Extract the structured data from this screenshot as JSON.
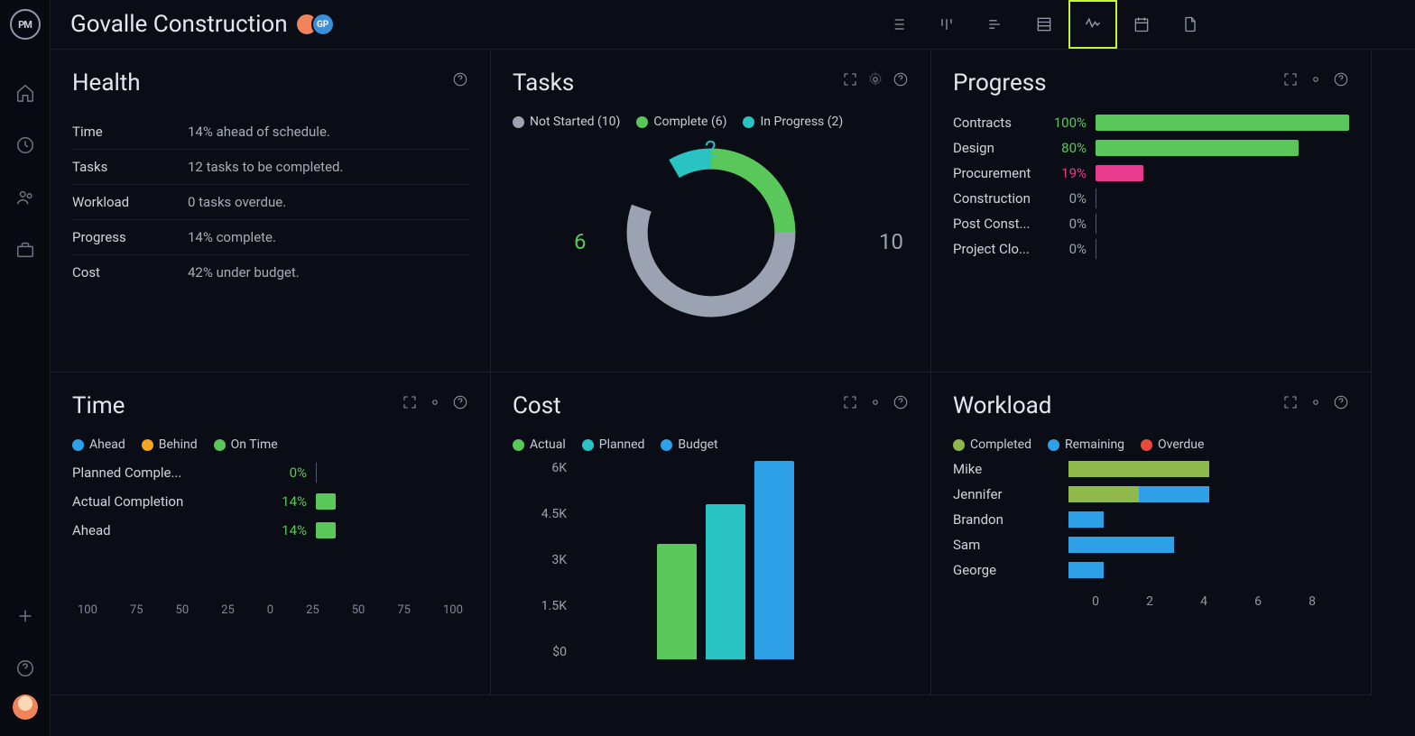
{
  "project_title": "Govalle Construction",
  "avatars": [
    {
      "bg": "#f0835a",
      "initials": ""
    },
    {
      "bg": "#3b8fd9",
      "initials": "GP"
    }
  ],
  "colors": {
    "green": "#5ac75a",
    "teal": "#29c3c3",
    "gray": "#9ba3b3",
    "blue": "#2da0e8",
    "pink": "#e83b8f",
    "olive": "#8fb94a",
    "orange": "#f5a623",
    "red": "#e84a3b"
  },
  "health": {
    "title": "Health",
    "rows": [
      {
        "label": "Time",
        "value": "14% ahead of schedule."
      },
      {
        "label": "Tasks",
        "value": "12 tasks to be completed."
      },
      {
        "label": "Workload",
        "value": "0 tasks overdue."
      },
      {
        "label": "Progress",
        "value": "14% complete."
      },
      {
        "label": "Cost",
        "value": "42% under budget."
      }
    ]
  },
  "tasks": {
    "title": "Tasks",
    "legend": [
      {
        "label": "Not Started (10)",
        "color": "#9ba3b3",
        "count": 10
      },
      {
        "label": "Complete (6)",
        "color": "#5ac75a",
        "count": 6
      },
      {
        "label": "In Progress (2)",
        "color": "#29c3c3",
        "count": 2
      }
    ],
    "chart_data": {
      "type": "pie",
      "series": [
        {
          "name": "Not Started",
          "value": 10
        },
        {
          "name": "Complete",
          "value": 6
        },
        {
          "name": "In Progress",
          "value": 2
        }
      ],
      "labels": [
        "10",
        "6",
        "2"
      ]
    }
  },
  "progress": {
    "title": "Progress",
    "rows": [
      {
        "label": "Contracts",
        "pct": "100%",
        "value": 100,
        "color": "#5ac75a"
      },
      {
        "label": "Design",
        "pct": "80%",
        "value": 80,
        "color": "#5ac75a"
      },
      {
        "label": "Procurement",
        "pct": "19%",
        "value": 19,
        "color": "#e83b8f"
      },
      {
        "label": "Construction",
        "pct": "0%",
        "value": 0,
        "color": "#555c6e"
      },
      {
        "label": "Post Const...",
        "pct": "0%",
        "value": 0,
        "color": "#555c6e"
      },
      {
        "label": "Project Clo...",
        "pct": "0%",
        "value": 0,
        "color": "#555c6e"
      }
    ]
  },
  "time": {
    "title": "Time",
    "legend": [
      {
        "label": "Ahead",
        "color": "#2da0e8"
      },
      {
        "label": "Behind",
        "color": "#f5a623"
      },
      {
        "label": "On Time",
        "color": "#5ac75a"
      }
    ],
    "rows": [
      {
        "label": "Planned Comple...",
        "pct": "0%",
        "value": 0
      },
      {
        "label": "Actual Completion",
        "pct": "14%",
        "value": 14
      },
      {
        "label": "Ahead",
        "pct": "14%",
        "value": 14
      }
    ],
    "axis": [
      "100",
      "75",
      "50",
      "25",
      "0",
      "25",
      "50",
      "75",
      "100"
    ]
  },
  "cost": {
    "title": "Cost",
    "legend": [
      {
        "label": "Actual",
        "color": "#5ac75a"
      },
      {
        "label": "Planned",
        "color": "#29c3c3"
      },
      {
        "label": "Budget",
        "color": "#2da0e8"
      }
    ],
    "chart_data": {
      "type": "bar",
      "categories": [
        "Actual",
        "Planned",
        "Budget"
      ],
      "values": [
        3500,
        4700,
        6000
      ],
      "yticks": [
        "6K",
        "4.5K",
        "3K",
        "1.5K",
        "$0"
      ],
      "ylim": [
        0,
        6000
      ]
    }
  },
  "workload": {
    "title": "Workload",
    "legend": [
      {
        "label": "Completed",
        "color": "#8fb94a"
      },
      {
        "label": "Remaining",
        "color": "#2da0e8"
      },
      {
        "label": "Overdue",
        "color": "#e84a3b"
      }
    ],
    "rows": [
      {
        "label": "Mike",
        "completed": 4,
        "remaining": 0
      },
      {
        "label": "Jennifer",
        "completed": 2,
        "remaining": 2
      },
      {
        "label": "Brandon",
        "completed": 0,
        "remaining": 1
      },
      {
        "label": "Sam",
        "completed": 0,
        "remaining": 3
      },
      {
        "label": "George",
        "completed": 0,
        "remaining": 1
      }
    ],
    "axis": [
      "0",
      "2",
      "4",
      "6",
      "8"
    ],
    "max": 8
  }
}
